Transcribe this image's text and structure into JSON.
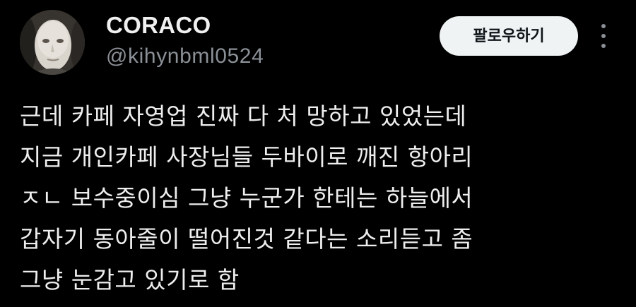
{
  "author": {
    "display_name": "CORACO",
    "handle": "@kihynbml0524"
  },
  "actions": {
    "follow_label": "팔로우하기",
    "more_icon": "more-vertical-icon"
  },
  "tweet": {
    "lines": [
      "근데 카페 자영업 진짜 다 처 망하고 있었는데",
      "지금 개인카페 사장님들 두바이로 깨진 항아리",
      "ㅈㄴ 보수중이심 그냥 누군가 한테는 하늘에서",
      "갑자기 동아줄이 떨어진것 같다는 소리듣고 좀",
      "그냥 눈감고 있기로 함"
    ]
  },
  "colors": {
    "background": "#000000",
    "primary_text": "#e7e9ea",
    "secondary_text": "#8b9097",
    "follow_button_bg": "#eff3f4",
    "follow_button_text": "#0f1419"
  }
}
